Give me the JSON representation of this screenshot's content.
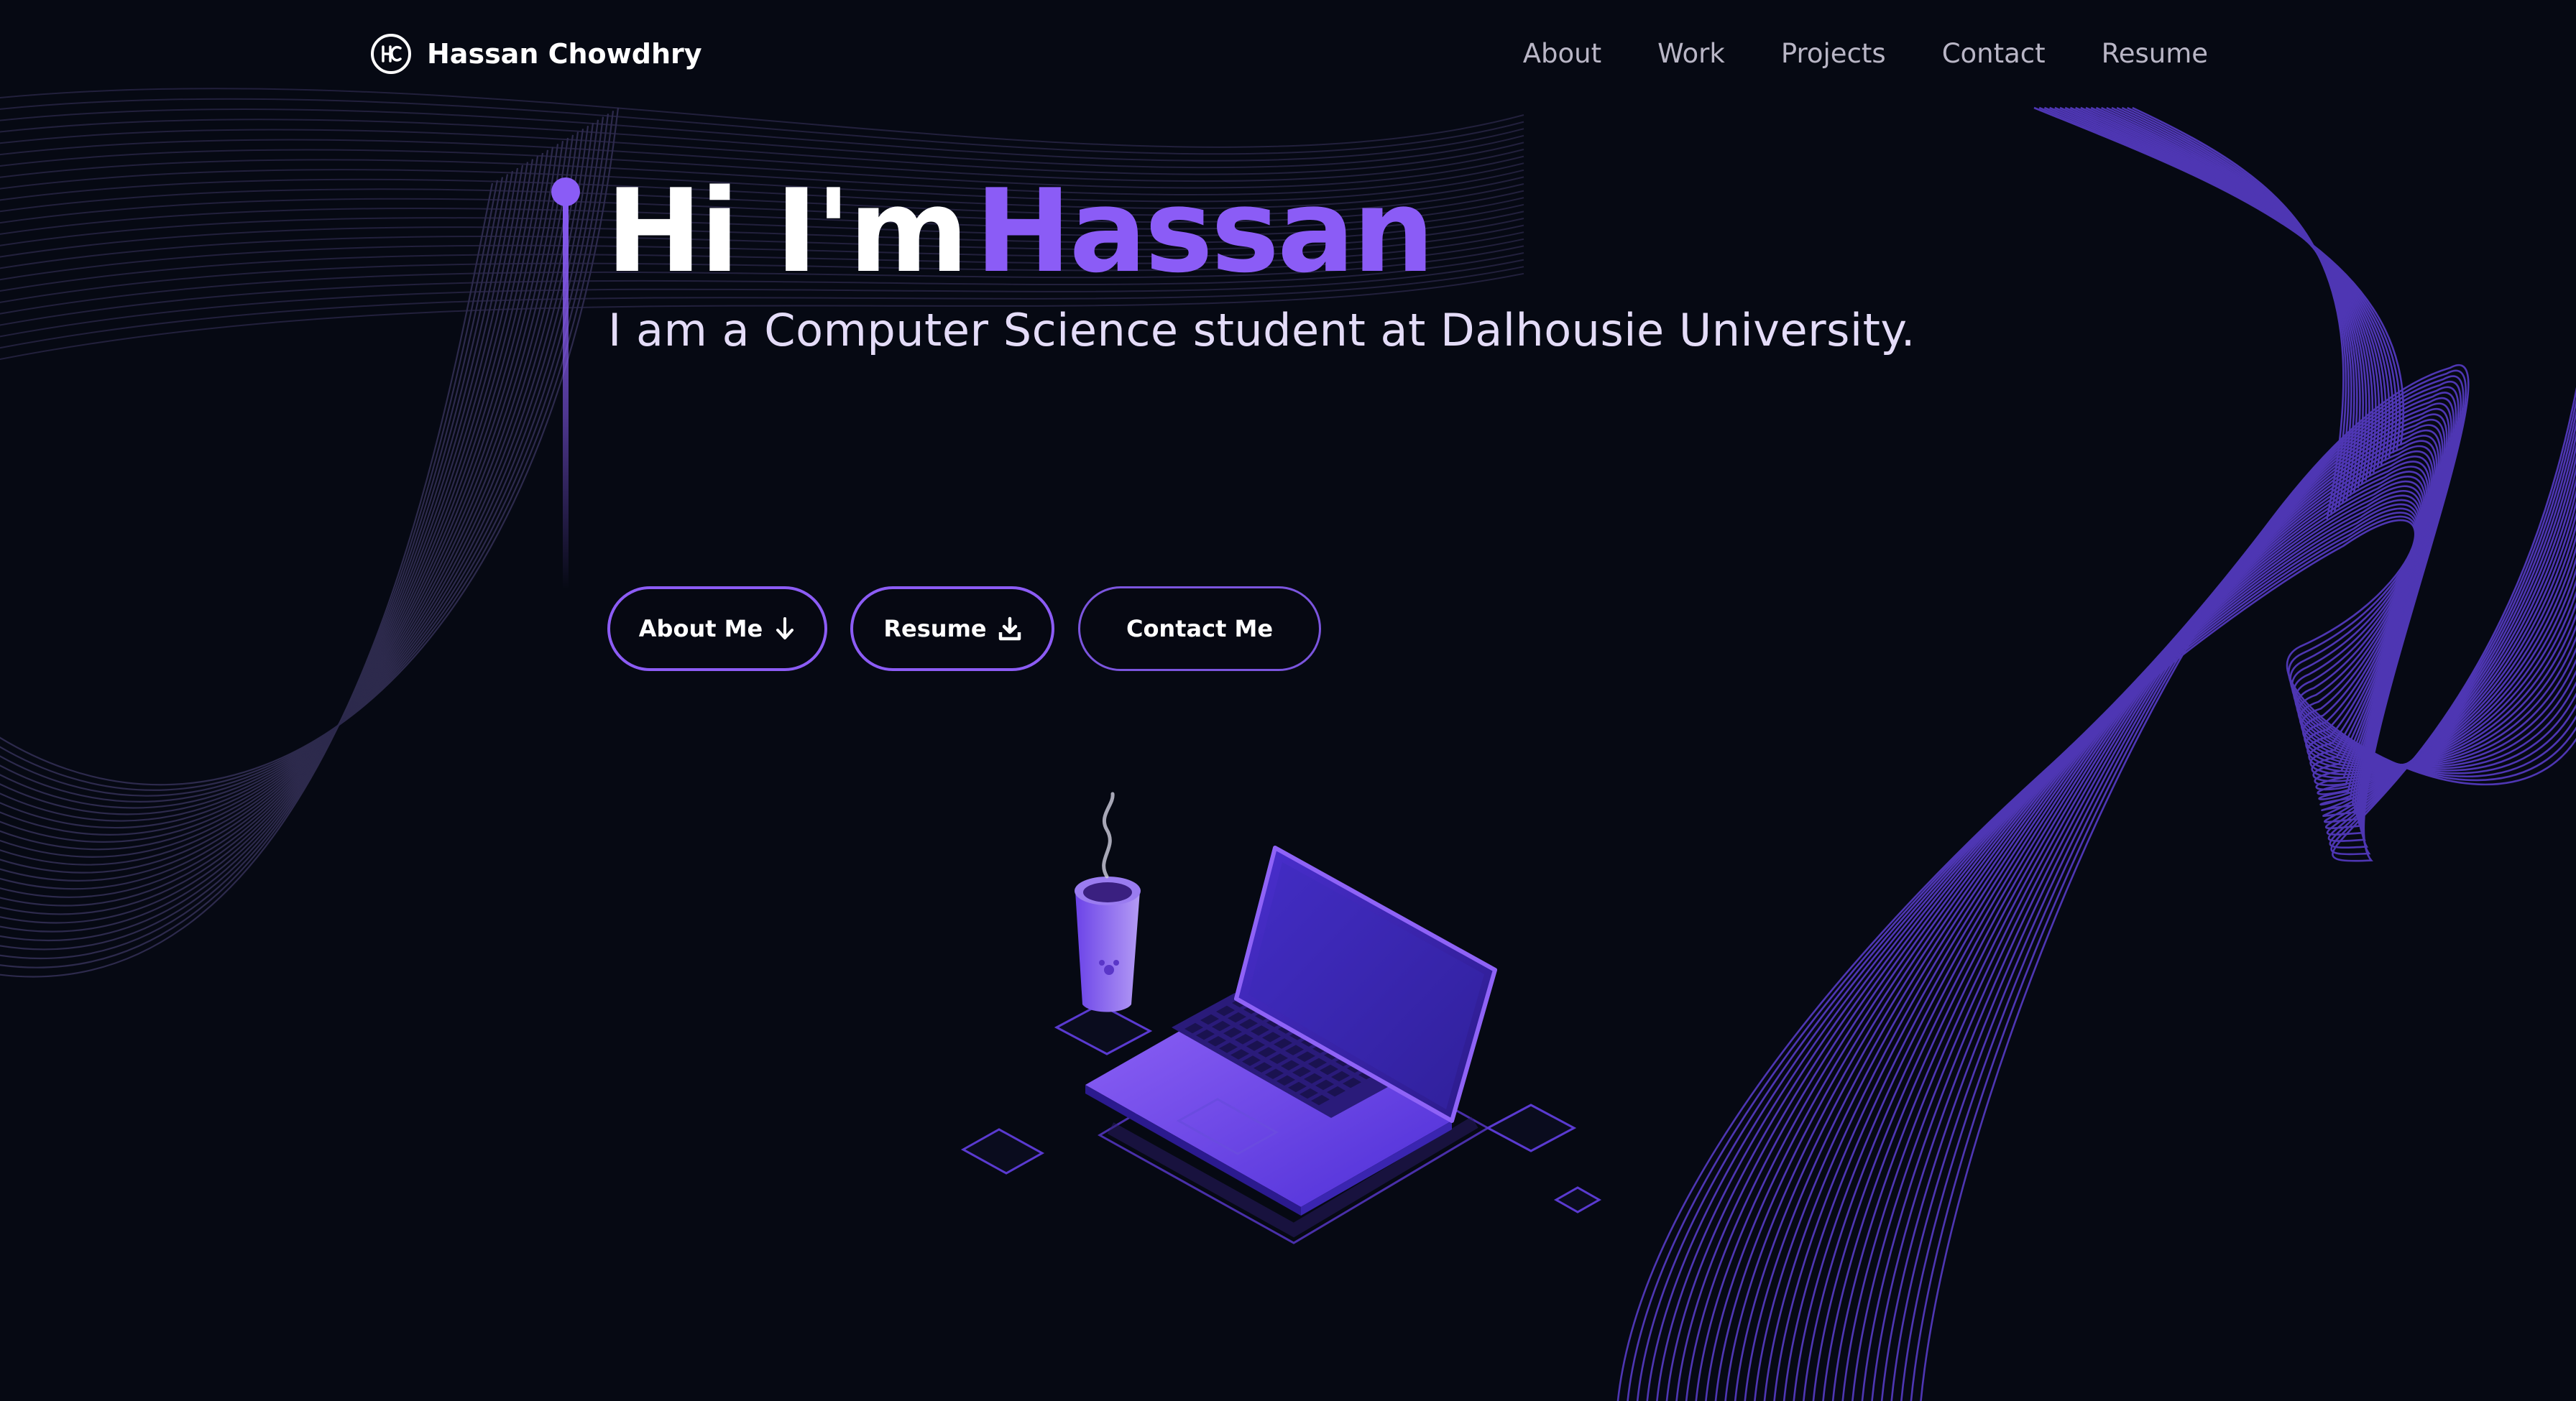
{
  "header": {
    "brand_name": "Hassan Chowdhry",
    "logo_icon": "hc-monogram-icon",
    "nav": [
      {
        "label": "About"
      },
      {
        "label": "Work"
      },
      {
        "label": "Projects"
      },
      {
        "label": "Contact"
      },
      {
        "label": "Resume"
      }
    ]
  },
  "hero": {
    "title_prefix": "Hi I'm",
    "title_name": "Hassan",
    "subtitle": "I am a Computer Science student at Dalhousie University.",
    "buttons": [
      {
        "label": "About Me",
        "icon": "arrow-down-icon"
      },
      {
        "label": "Resume",
        "icon": "download-icon"
      },
      {
        "label": "Contact Me"
      }
    ]
  },
  "colors": {
    "background": "#060913",
    "accent": "#8b5cf6",
    "nav_text": "#b9b6c6",
    "subtitle_text": "#e4dcf8"
  }
}
